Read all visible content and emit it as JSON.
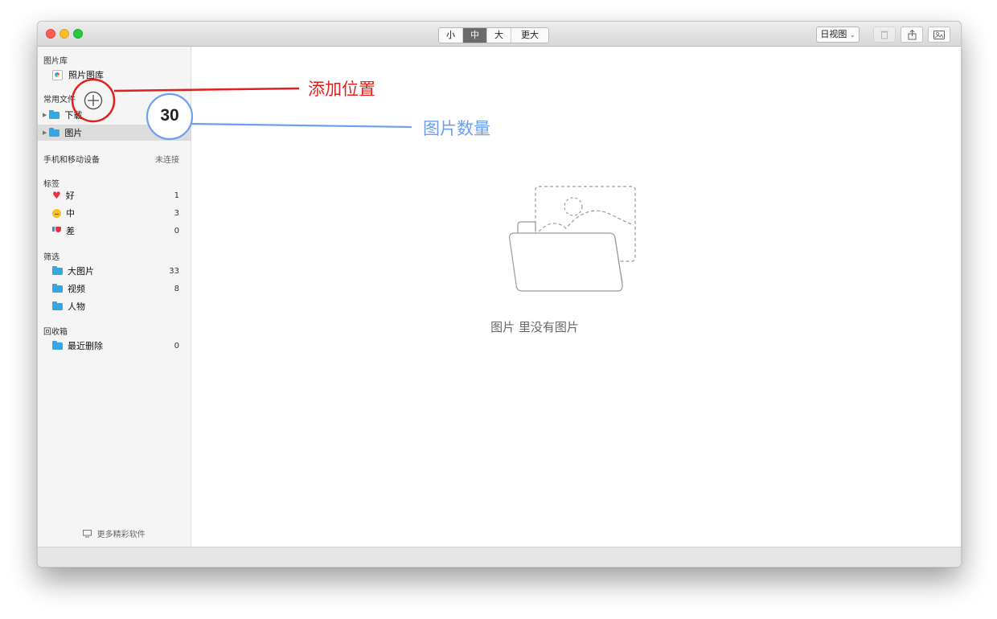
{
  "toolbar": {
    "size_options": [
      {
        "label": "小"
      },
      {
        "label": "中",
        "active": true
      },
      {
        "label": "大"
      },
      {
        "label": "更大"
      }
    ],
    "view_mode": "日视图",
    "view_mode_icon": "chevron-down-icon"
  },
  "sidebar": {
    "library": {
      "header": "图片库",
      "items": [
        {
          "label": "照片图库",
          "icon": "photos-app-icon"
        }
      ]
    },
    "favorites": {
      "header": "常用文件",
      "items": [
        {
          "label": "下载",
          "icon": "folder-icon"
        },
        {
          "label": "图片",
          "icon": "folder-icon",
          "selected": true
        }
      ]
    },
    "devices": {
      "header": "手机和移动设备",
      "status": "未连接"
    },
    "tags": {
      "header": "标签",
      "items": [
        {
          "label": "好",
          "count": "1",
          "icon": "heart-icon"
        },
        {
          "label": "中",
          "count": "3",
          "icon": "neutral-face-icon"
        },
        {
          "label": "差",
          "count": "0",
          "icon": "thumbs-down-icon"
        }
      ]
    },
    "filters": {
      "header": "筛选",
      "items": [
        {
          "label": "大图片",
          "count": "33"
        },
        {
          "label": "视频",
          "count": "8"
        },
        {
          "label": "人物",
          "count": ""
        }
      ]
    },
    "trash": {
      "header": "回收箱",
      "items": [
        {
          "label": "最近删除",
          "count": "0"
        }
      ]
    },
    "footer_link": "更多精彩软件",
    "footer_icon": "monitor-icon"
  },
  "main": {
    "empty_message": "图片 里没有图片",
    "empty_icon": "empty-folder-illustration"
  },
  "annotations": {
    "add_location": {
      "label": "添加位置",
      "color": "#e0211d"
    },
    "photo_count": {
      "label": "图片数量",
      "value": "30",
      "color": "#6d9ff0"
    }
  }
}
